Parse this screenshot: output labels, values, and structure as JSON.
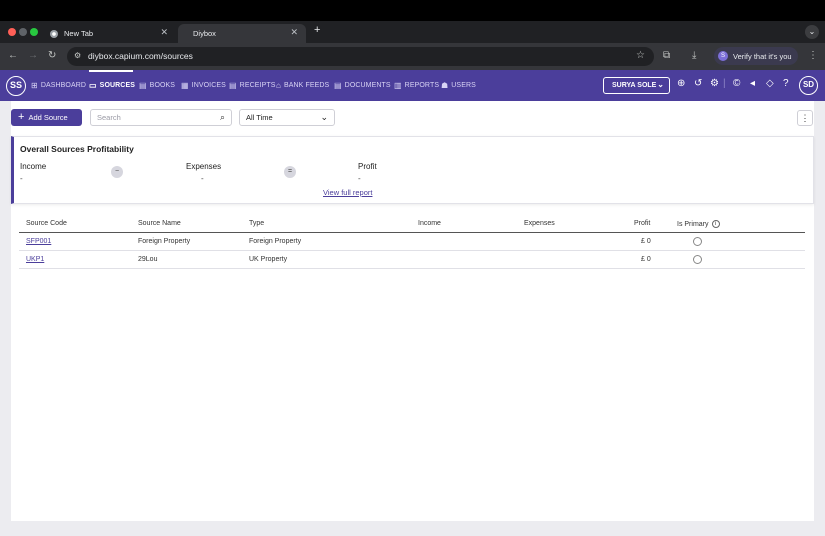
{
  "browser": {
    "tabs": [
      {
        "title": "New Tab",
        "active": false
      },
      {
        "title": "Diybox",
        "active": true
      }
    ],
    "new_tab_label": "+",
    "url": "diybox.capium.com/sources",
    "verify_label": "Verify that it's you"
  },
  "app": {
    "user_initials": "SS",
    "nav": [
      {
        "label": "DASHBOARD",
        "icon": "grid-icon"
      },
      {
        "label": "SOURCES",
        "icon": "folder-icon",
        "active": true
      },
      {
        "label": "BOOKS",
        "icon": "book-icon"
      },
      {
        "label": "INVOICES",
        "icon": "invoice-icon"
      },
      {
        "label": "RECEIPTS",
        "icon": "receipt-icon"
      },
      {
        "label": "BANK FEEDS",
        "icon": "bank-icon"
      },
      {
        "label": "DOCUMENTS",
        "icon": "document-icon"
      },
      {
        "label": "REPORTS",
        "icon": "chart-icon"
      },
      {
        "label": "USERS",
        "icon": "users-icon"
      }
    ],
    "company": "SURYA SOLE",
    "profile_initials": "SD"
  },
  "toolbar": {
    "add_source_label": "Add Source",
    "search_placeholder": "Search",
    "period": "All Time"
  },
  "profitability": {
    "title": "Overall Sources Profitability",
    "income_label": "Income",
    "income_value": "-",
    "minus_op": "−",
    "expenses_label": "Expenses",
    "expenses_value": "-",
    "equals_op": "=",
    "profit_label": "Profit",
    "profit_value": "-",
    "view_report_label": "View full report"
  },
  "table": {
    "columns": [
      "Source Code",
      "Source Name",
      "Type",
      "Income",
      "Expenses",
      "Profit",
      "Is Primary"
    ],
    "rows": [
      {
        "code": "SFP001",
        "name": "Foreign Property",
        "type": "Foreign Property",
        "income": "",
        "expenses": "",
        "profit": "£ 0"
      },
      {
        "code": "UKP1",
        "name": "29Lou",
        "type": "UK Property",
        "income": "",
        "expenses": "",
        "profit": "£ 0"
      }
    ]
  }
}
